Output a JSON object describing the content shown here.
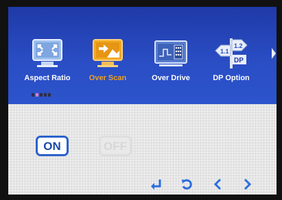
{
  "osd": {
    "menu_items": [
      {
        "label": "Aspect Ratio",
        "icon": "aspect-ratio-icon",
        "selected": false
      },
      {
        "label": "Over Scan",
        "icon": "over-scan-icon",
        "selected": true
      },
      {
        "label": "Over Drive",
        "icon": "over-drive-icon",
        "selected": false
      },
      {
        "label": "DP Option",
        "icon": "dp-option-icon",
        "selected": false
      }
    ],
    "dp_sign": {
      "left": "1.1",
      "right": "1.2",
      "bottom": "DP"
    },
    "page_indicator": {
      "total": 5,
      "current": 1
    },
    "option_on": "ON",
    "option_off": "OFF",
    "nav_buttons": [
      "enter-icon",
      "back-icon",
      "left-arrow-icon",
      "right-arrow-icon"
    ],
    "colors": {
      "top_bg": "#2a4dc4",
      "selected": "#f0a020",
      "on_accent": "#2a62cc",
      "nav": "#2a6de0"
    }
  }
}
